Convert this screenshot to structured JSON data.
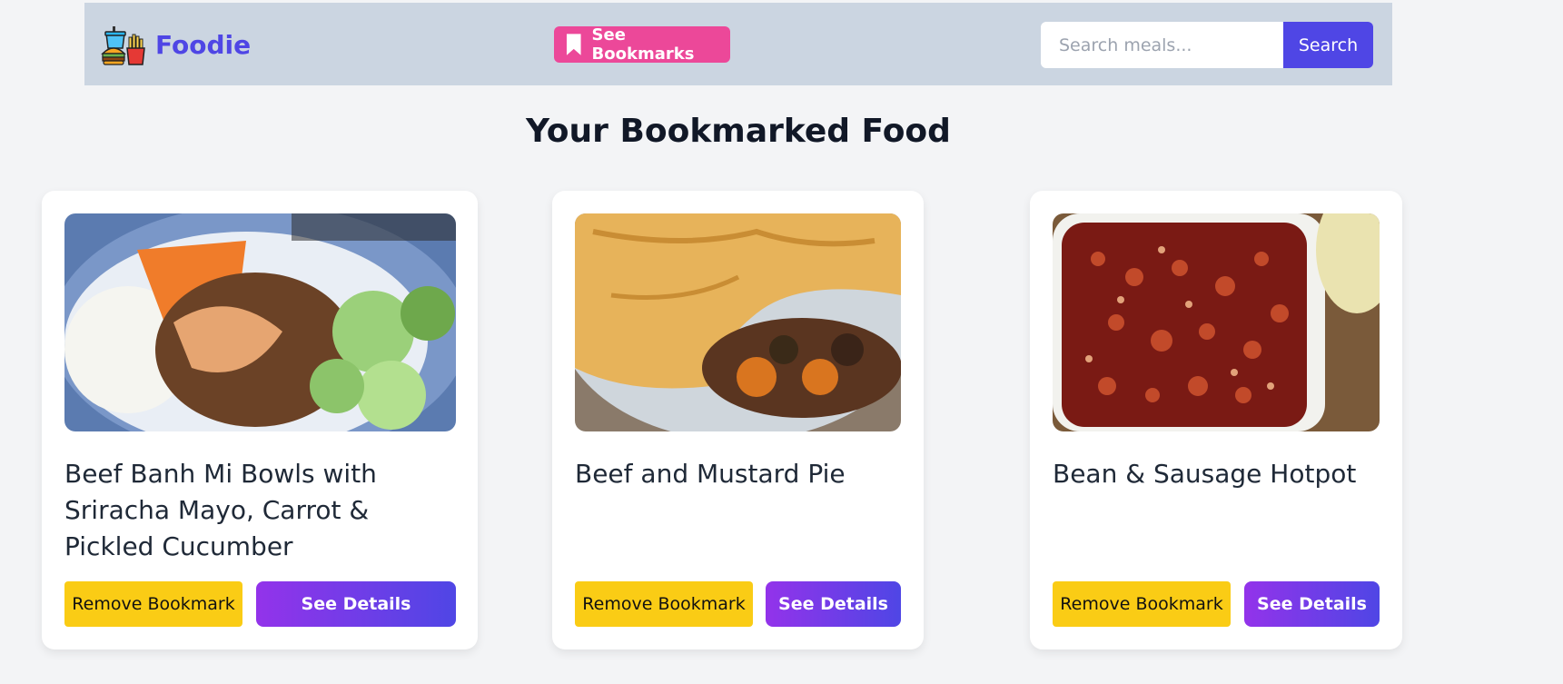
{
  "navbar": {
    "brand": "Foodie",
    "bookmarks_button": "See Bookmarks",
    "search_placeholder": "Search meals...",
    "search_button": "Search"
  },
  "page_title": "Your Bookmarked Food",
  "cards": [
    {
      "title": "Beef Banh Mi Bowls with Sriracha Mayo, Carrot & Pickled Cucumber",
      "remove_label": "Remove Bookmark",
      "details_label": "See Details"
    },
    {
      "title": "Beef and Mustard Pie",
      "remove_label": "Remove Bookmark",
      "details_label": "See Details"
    },
    {
      "title": "Bean & Sausage Hotpot",
      "remove_label": "Remove Bookmark",
      "details_label": "See Details"
    }
  ],
  "colors": {
    "brand": "#4f46e5",
    "bookmark_button": "#ec4899",
    "remove_button": "#facc15",
    "details_gradient": [
      "#9333ea",
      "#4f46e5"
    ],
    "navbar_bg": "#cbd5e1"
  },
  "icons": {
    "logo": "fast-food-icon",
    "bookmark": "bookmark-icon"
  }
}
